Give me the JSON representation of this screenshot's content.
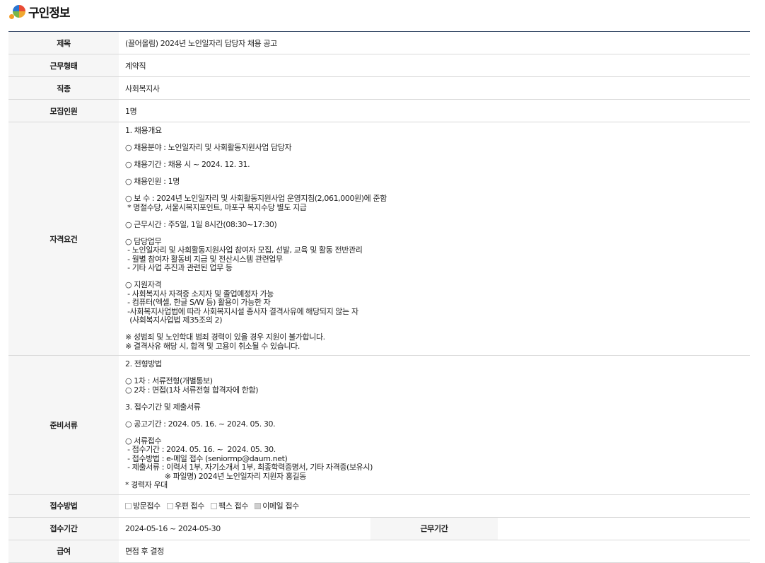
{
  "header": {
    "title": "구인정보",
    "logo_icon": "colorful-circle-logo-icon"
  },
  "rows": {
    "title": {
      "label": "제목",
      "value": "(끌어올림) 2024년 노인일자리 담당자 채용 공고"
    },
    "employment_type": {
      "label": "근무형태",
      "value": "계약직"
    },
    "job_type": {
      "label": "직종",
      "value": "사회복지사"
    },
    "headcount": {
      "label": "모집인원",
      "value": "1명"
    },
    "qualifications": {
      "label": "자격요건",
      "lines": [
        "1. 채용개요",
        "",
        "○ 채용분야 : 노인일자리 및 사회활동지원사업 담당자",
        "",
        "○ 채용기간 : 채용 시 ~ 2024. 12. 31.",
        "",
        "○ 채용인원 : 1명",
        "",
        "○ 보 수 : 2024년 노인일자리 및 사회활동지원사업 운영지침(2,061,000원)에 준함",
        " * 명절수당, 서울시복지포인트, 마포구 복지수당 별도 지급",
        "",
        "○ 근무시간 : 주5일, 1일 8시간(08:30~17:30)",
        "",
        "○ 담당업무",
        " - 노인일자리 및 사회활동지원사업 참여자 모집, 선발, 교육 및 활동 전반관리",
        " - 월별 참여자 활동비 지급 및 전산시스템 관련업무",
        " - 기타 사업 추진과 관련된 업무 등",
        "",
        "○ 지원자격",
        " - 사회복지사 자격증 소지자 및 졸업예정자 가능",
        " - 컴퓨터(엑셀, 한글 S/W 등) 활용이 가능한 자",
        " -사회복지사업법에 따라 사회복지시설 종사자 결격사유에 해당되지 않는 자",
        "  (사회복지사업법 제35조의 2)",
        "",
        "※ 성범죄 및 노인학대 범죄 경력이 있을 경우 지원이 불가합니다.",
        "※ 결격사유 해당 시, 합격 및 고용이 취소될 수 있습니다."
      ]
    },
    "documents": {
      "label": "준비서류",
      "lines": [
        "2. 전형방법",
        "",
        "○ 1차 : 서류전형(개별통보)",
        "○ 2차 : 면접(1차 서류전형 합격자에 한함)",
        "",
        "3. 접수기간 및 제출서류",
        "",
        "○ 공고기간 : 2024. 05. 16. ~ 2024. 05. 30.",
        "",
        "○ 서류접수",
        " - 접수기간 : 2024. 05. 16. ~  2024. 05. 30.",
        " - 접수방법 : e-메일 접수 (seniormp@daum.net)",
        " - 제출서류 : 이력서 1부, 자기소개서 1부, 최종학력증명서, 기타 자격증(보유시)",
        "                  ※ 파일명) 2024년 노인일자리 지원자 홍길동",
        "* 경력자 우대"
      ]
    },
    "application_method": {
      "label": "접수방법",
      "options": [
        {
          "label": "방문접수",
          "checked": false
        },
        {
          "label": "우편 접수",
          "checked": false
        },
        {
          "label": "팩스 접수",
          "checked": false
        },
        {
          "label": "이메일 접수",
          "checked": true
        }
      ]
    },
    "application_period": {
      "label": "접수기간",
      "value": "2024-05-16 ~ 2024-05-30",
      "work_label": "근무기간",
      "work_value": ""
    },
    "salary": {
      "label": "급여",
      "value": "면접 후 결정"
    }
  }
}
